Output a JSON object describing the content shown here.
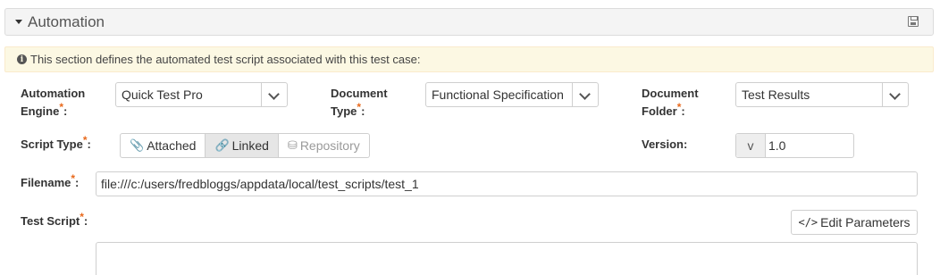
{
  "section": {
    "title": "Automation",
    "collapse_icon": "caret-down-icon",
    "save_icon": "save-icon"
  },
  "info": {
    "icon": "info-circle-icon",
    "text": "This section defines the automated test script associated with this test case:"
  },
  "fields": {
    "automation_engine": {
      "label_line1": "Automation",
      "label_line2": "Engine",
      "value": "Quick Test Pro"
    },
    "document_type": {
      "label_line1": "Document",
      "label_line2": "Type",
      "value": "Functional Specification"
    },
    "document_folder": {
      "label_line1": "Document",
      "label_line2": "Folder",
      "value": "Test Results"
    },
    "script_type": {
      "label": "Script Type",
      "options": [
        {
          "label": "Attached",
          "icon": "paperclip-icon",
          "active": false
        },
        {
          "label": "Linked",
          "icon": "link-icon",
          "active": true
        },
        {
          "label": "Repository",
          "icon": "database-icon",
          "active": false,
          "disabled": true
        }
      ]
    },
    "version": {
      "label": "Version",
      "prefix": "v",
      "value": "1.0"
    },
    "filename": {
      "label": "Filename",
      "value": "file:///c:/users/fredbloggs/appdata/local/test_scripts/test_1"
    },
    "test_script": {
      "label": "Test Script",
      "edit_button": "Edit Parameters"
    }
  },
  "required_marker": "*",
  "colon": ":"
}
